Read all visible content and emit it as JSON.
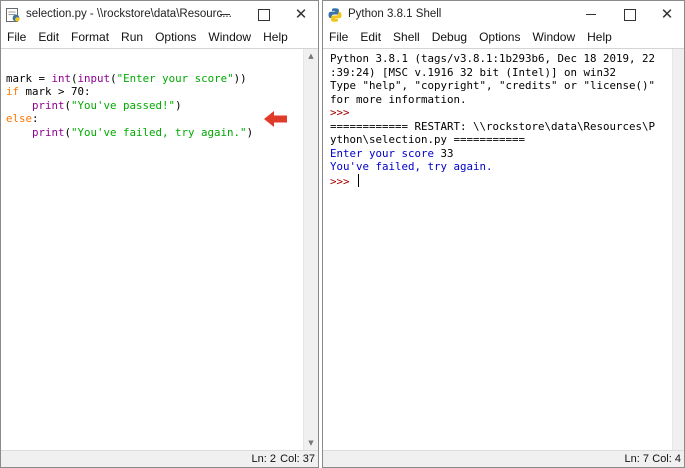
{
  "editor": {
    "title": "selection.py - \\\\rockstore\\data\\Resourc...",
    "menu": [
      "File",
      "Edit",
      "Format",
      "Run",
      "Options",
      "Window",
      "Help"
    ],
    "code": {
      "l1": {
        "a": "mark = ",
        "b": "int",
        "c": "(",
        "d": "input",
        "e": "(",
        "f": "\"Enter your score\"",
        "g": "))"
      },
      "l2": {
        "a": "if",
        "b": " mark > 70:"
      },
      "l3": {
        "a": "    ",
        "b": "print",
        "c": "(",
        "d": "\"You've passed!\"",
        "e": ")"
      },
      "l4": {
        "a": "else",
        "b": ":"
      },
      "l5": {
        "a": "    ",
        "b": "print",
        "c": "(",
        "d": "\"You've failed, try again.\"",
        "e": ")"
      }
    },
    "status": {
      "line": "Ln: 2",
      "col": "Col: 37"
    },
    "annotation_color": "#e03a2a"
  },
  "shell": {
    "title": "Python 3.8.1 Shell",
    "menu": [
      "File",
      "Edit",
      "Shell",
      "Debug",
      "Options",
      "Window",
      "Help"
    ],
    "lines": {
      "banner1": "Python 3.8.1 (tags/v3.8.1:1b293b6, Dec 18 2019, 22",
      "banner2": ":39:24) [MSC v.1916 32 bit (Intel)] on win32",
      "banner3": "Type \"help\", \"copyright\", \"credits\" or \"license()\"",
      "banner4": "for more information.",
      "prompt1": ">>>",
      "restart1": "============ RESTART: \\\\rockstore\\data\\Resources\\P",
      "restart2": "ython\\selection.py ===========",
      "input_prompt": "Enter your score ",
      "input_value": "33",
      "output": "You've failed, try again.",
      "prompt2": ">>> "
    },
    "status": {
      "line": "Ln: 7",
      "col": "Col: 4"
    }
  },
  "icons": {
    "editor_title": "idle-python-icon",
    "shell_title": "python-shell-icon",
    "minimize": "minimize-icon",
    "maximize": "maximize-icon",
    "close": "close-icon",
    "annotation": "red-arrow-icon"
  },
  "colors": {
    "keyword": "#ff7700",
    "builtin": "#900090",
    "string": "#00aa00",
    "shell_output": "#0000c8",
    "shell_prompt": "#a30000"
  }
}
